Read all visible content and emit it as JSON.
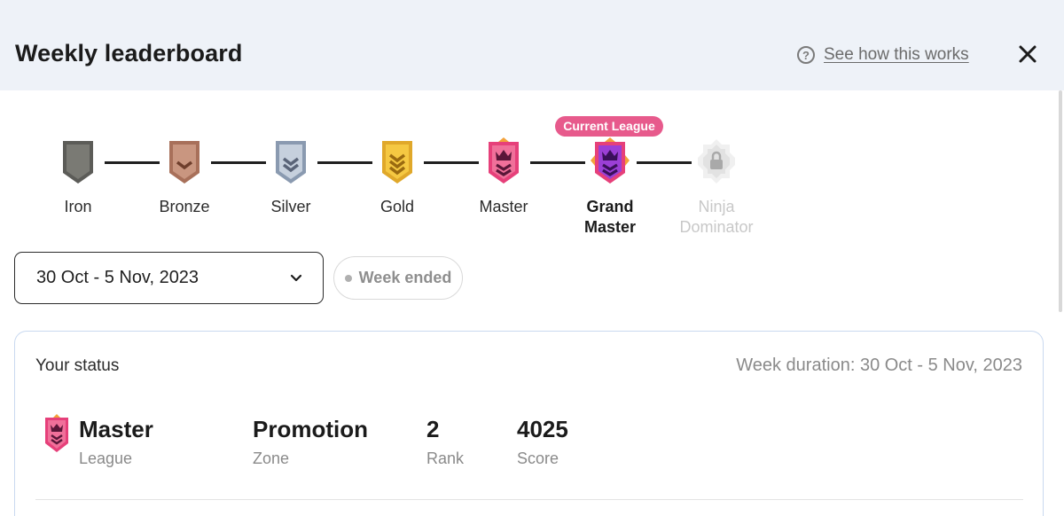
{
  "header": {
    "title": "Weekly leaderboard",
    "help_link": "See how this works",
    "help_icon_glyph": "?",
    "close_icon": "close-icon"
  },
  "leagues": {
    "current_tag": "Current League",
    "items": [
      {
        "name": "Iron",
        "state": "achieved",
        "icon": "shield-plain-icon"
      },
      {
        "name": "Bronze",
        "state": "achieved",
        "icon": "shield-chevron-icon"
      },
      {
        "name": "Silver",
        "state": "achieved",
        "icon": "shield-double-chevron-icon"
      },
      {
        "name": "Gold",
        "state": "achieved",
        "icon": "shield-triple-chevron-icon"
      },
      {
        "name": "Master",
        "state": "achieved",
        "icon": "crown-shield-icon"
      },
      {
        "name_line1": "Grand",
        "name_line2": "Master",
        "state": "current",
        "icon": "crown-shield-purple-icon"
      },
      {
        "name_line1": "Ninja",
        "name_line2": "Dominator",
        "state": "locked",
        "icon": "lock-icon"
      }
    ]
  },
  "filters": {
    "week_value": "30 Oct - 5 Nov, 2023",
    "week_status": "Week ended"
  },
  "status": {
    "heading": "Your status",
    "week_duration": "Week duration: 30 Oct - 5 Nov, 2023",
    "league_value": "Master",
    "league_label": "League",
    "zone_value": "Promotion",
    "zone_label": "Zone",
    "rank_value": "2",
    "rank_label": "Rank",
    "score_value": "4025",
    "score_label": "Score"
  },
  "colors": {
    "header_bg": "#eef2f8",
    "current_tag": "#e75a8c",
    "master_pink": "#e6407a",
    "grand_master_purple": "#9b3fd6"
  }
}
